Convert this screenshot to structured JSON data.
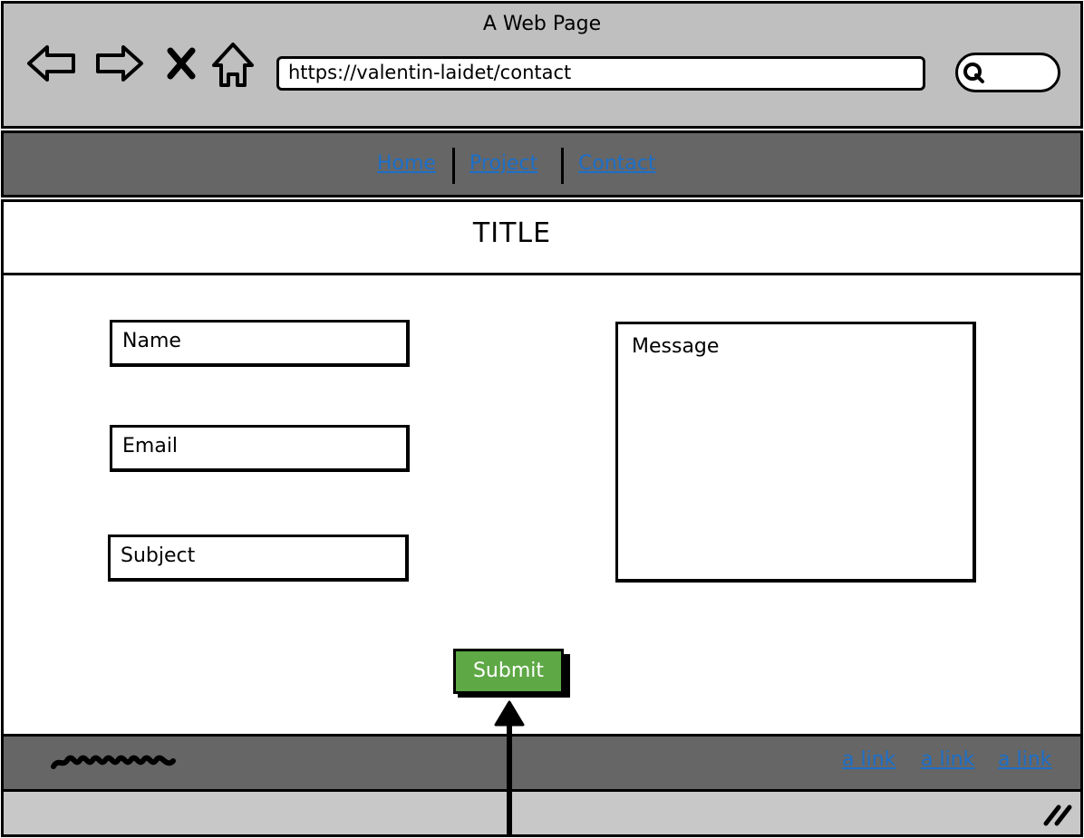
{
  "window": {
    "title": "A Web Page",
    "url": "https://valentin-laidet/contact"
  },
  "nav": {
    "links": [
      "Home",
      "Project",
      "Contact"
    ]
  },
  "page": {
    "title": "TITLE"
  },
  "form": {
    "name_label": "Name",
    "email_label": "Email",
    "subject_label": "Subject",
    "message_label": "Message",
    "submit_label": "Submit"
  },
  "footer": {
    "links": [
      "a link",
      "a link",
      "a link"
    ]
  },
  "icons": {
    "back": "back-arrow-icon",
    "forward": "forward-arrow-icon",
    "close": "close-icon",
    "home": "home-icon",
    "search": "search-icon",
    "resize": "resize-grip-icon"
  },
  "colors": {
    "chrome": "#bfbfbf",
    "navbar": "#666666",
    "link": "#1c6fc9",
    "submit": "#5ea845"
  }
}
